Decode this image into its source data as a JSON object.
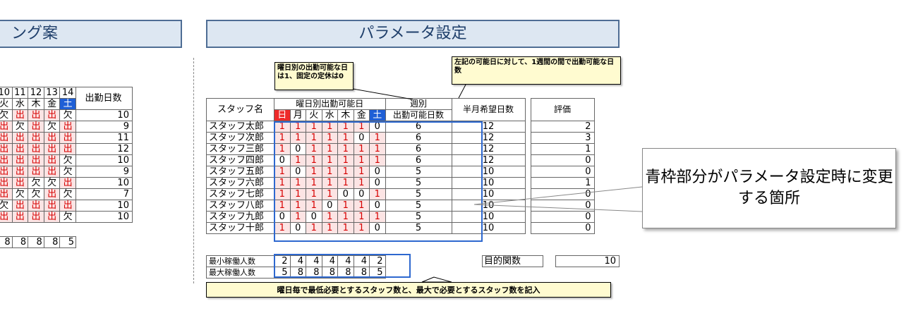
{
  "left_title": "ング案",
  "right_title": "パラメータ設定",
  "schedule": {
    "days": [
      "10",
      "11",
      "12",
      "13",
      "14"
    ],
    "weekdays": [
      "火",
      "水",
      "木",
      "金",
      "土"
    ],
    "header_days_label": "出勤日数",
    "rows": [
      {
        "cells": [
          "欠",
          "出",
          "出",
          "出",
          "欠"
        ],
        "total": "10"
      },
      {
        "cells": [
          "出",
          "欠",
          "出",
          "欠",
          "出"
        ],
        "total": "9"
      },
      {
        "cells": [
          "出",
          "出",
          "出",
          "出",
          "出"
        ],
        "total": "11"
      },
      {
        "cells": [
          "出",
          "出",
          "出",
          "出",
          "出"
        ],
        "total": "12"
      },
      {
        "cells": [
          "出",
          "出",
          "出",
          "出",
          "欠"
        ],
        "total": "10"
      },
      {
        "cells": [
          "出",
          "出",
          "出",
          "出",
          "欠"
        ],
        "total": "9"
      },
      {
        "cells": [
          "出",
          "出",
          "欠",
          "欠",
          "出"
        ],
        "total": "10"
      },
      {
        "cells": [
          "出",
          "欠",
          "欠",
          "出",
          "欠"
        ],
        "total": "7"
      },
      {
        "cells": [
          "欠",
          "出",
          "出",
          "出",
          "出"
        ],
        "total": "10"
      },
      {
        "cells": [
          "出",
          "出",
          "出",
          "出",
          "欠"
        ],
        "total": "10"
      }
    ],
    "footer": [
      "8",
      "8",
      "8",
      "8",
      "5"
    ]
  },
  "params": {
    "col_staff": "スタッフ名",
    "col_avail": "曜日別出勤可能日",
    "col_weekly": "週別",
    "col_weekly2": "出勤可能日数",
    "col_half": "半月希望日数",
    "col_eval": "評価",
    "weekdays": [
      "日",
      "月",
      "火",
      "水",
      "木",
      "金",
      "土"
    ],
    "rows": [
      {
        "name": "スタッフ太郎",
        "days": [
          "1",
          "1",
          "1",
          "1",
          "1",
          "1",
          "0"
        ],
        "weekly": "6",
        "half": "12",
        "eval": "2"
      },
      {
        "name": "スタッフ次郎",
        "days": [
          "1",
          "1",
          "1",
          "1",
          "1",
          "0",
          "1"
        ],
        "weekly": "6",
        "half": "12",
        "eval": "3"
      },
      {
        "name": "スタッフ三郎",
        "days": [
          "1",
          "0",
          "1",
          "1",
          "1",
          "1",
          "1"
        ],
        "weekly": "6",
        "half": "12",
        "eval": "1"
      },
      {
        "name": "スタッフ四郎",
        "days": [
          "0",
          "1",
          "1",
          "1",
          "1",
          "1",
          "1"
        ],
        "weekly": "6",
        "half": "12",
        "eval": "0"
      },
      {
        "name": "スタッフ五郎",
        "days": [
          "1",
          "0",
          "1",
          "1",
          "1",
          "1",
          "0"
        ],
        "weekly": "5",
        "half": "10",
        "eval": "0"
      },
      {
        "name": "スタッフ六郎",
        "days": [
          "1",
          "1",
          "1",
          "1",
          "1",
          "1",
          "0"
        ],
        "weekly": "5",
        "half": "10",
        "eval": "1"
      },
      {
        "name": "スタッフ七郎",
        "days": [
          "1",
          "1",
          "1",
          "1",
          "0",
          "0",
          "1"
        ],
        "weekly": "5",
        "half": "10",
        "eval": "0"
      },
      {
        "name": "スタッフ八郎",
        "days": [
          "1",
          "1",
          "1",
          "0",
          "1",
          "1",
          "0"
        ],
        "weekly": "5",
        "half": "10",
        "eval": "0"
      },
      {
        "name": "スタッフ九郎",
        "days": [
          "0",
          "1",
          "0",
          "1",
          "1",
          "1",
          "1"
        ],
        "weekly": "5",
        "half": "10",
        "eval": "0"
      },
      {
        "name": "スタッフ十郎",
        "days": [
          "1",
          "0",
          "1",
          "1",
          "1",
          "1",
          "0"
        ],
        "weekly": "5",
        "half": "10",
        "eval": "0"
      }
    ],
    "min_label": "最小稼働人数",
    "max_label": "最大稼働人数",
    "min_values": [
      "2",
      "4",
      "4",
      "4",
      "4",
      "4",
      "2"
    ],
    "max_values": [
      "5",
      "8",
      "8",
      "8",
      "8",
      "8",
      "5"
    ],
    "objective_label": "目的関数",
    "objective_value": "10"
  },
  "notes": {
    "note1": "曜日別の出勤可能な日は1、固定の定休は0",
    "note2": "左記の可能日に対して、1週間の間で出勤可能な日数",
    "note3": "曜日毎で最低必要とするスタッフ数と、最大で必要とするスタッフ数を記入",
    "callout": "青枠部分がパラメータ設定時に変更する箇所"
  },
  "colors": {
    "frame_blue": "#2e68cf",
    "header_bg": "#dde7f2",
    "pink": "#fce4e4",
    "red": "#d60000"
  }
}
